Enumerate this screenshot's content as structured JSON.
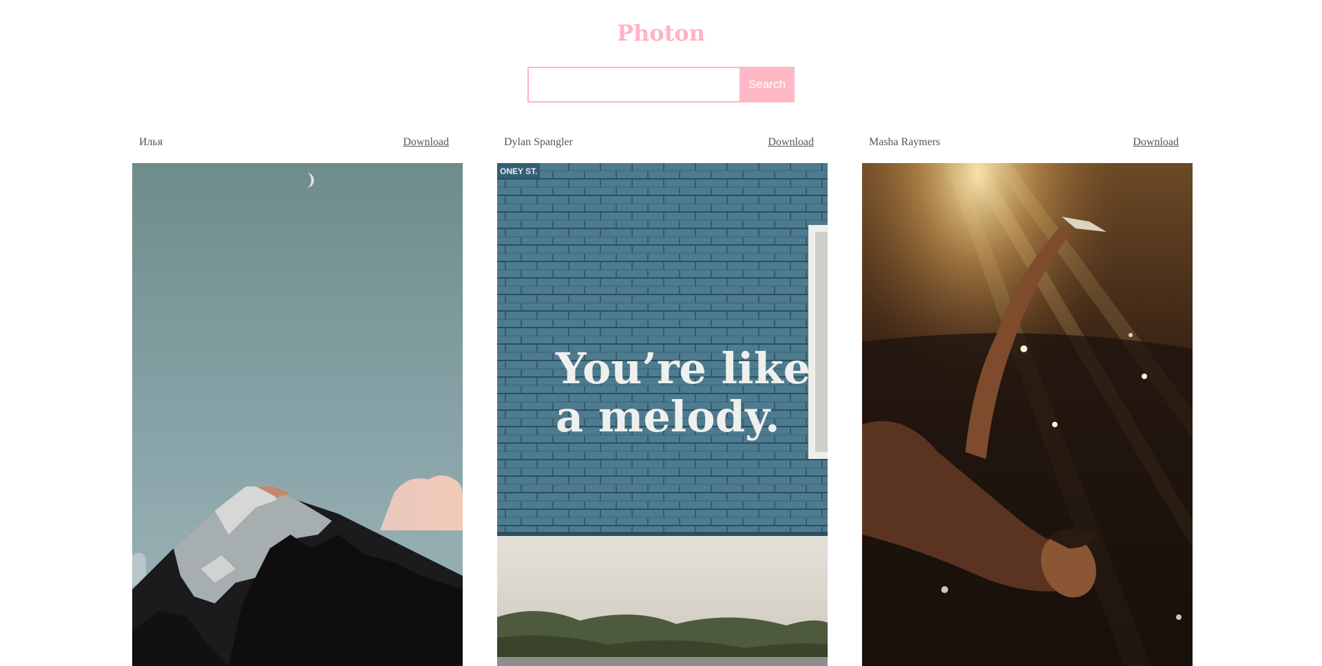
{
  "header": {
    "logo_text": "Photon"
  },
  "search": {
    "placeholder": "",
    "value": "",
    "button_label": "Search"
  },
  "photos": [
    {
      "author": "Илья",
      "download_label": "Download",
      "subject": "snow-capped mountain peak under a pale teal sky with a crescent moon"
    },
    {
      "author": "Dylan Spangler",
      "download_label": "Download",
      "subject": "blue brick wall with painted lettering",
      "sign_text": "ONEY ST.",
      "mural_line_1": "You’re like",
      "mural_line_2": "a melody."
    },
    {
      "author": "Masha Raymers",
      "download_label": "Download",
      "subject": "woman lying in warm sunbeams holding a glass prism"
    }
  ],
  "colors": {
    "brand": "#ffb3c3",
    "button_bg": "#ffb8c6",
    "text": "#555555"
  }
}
